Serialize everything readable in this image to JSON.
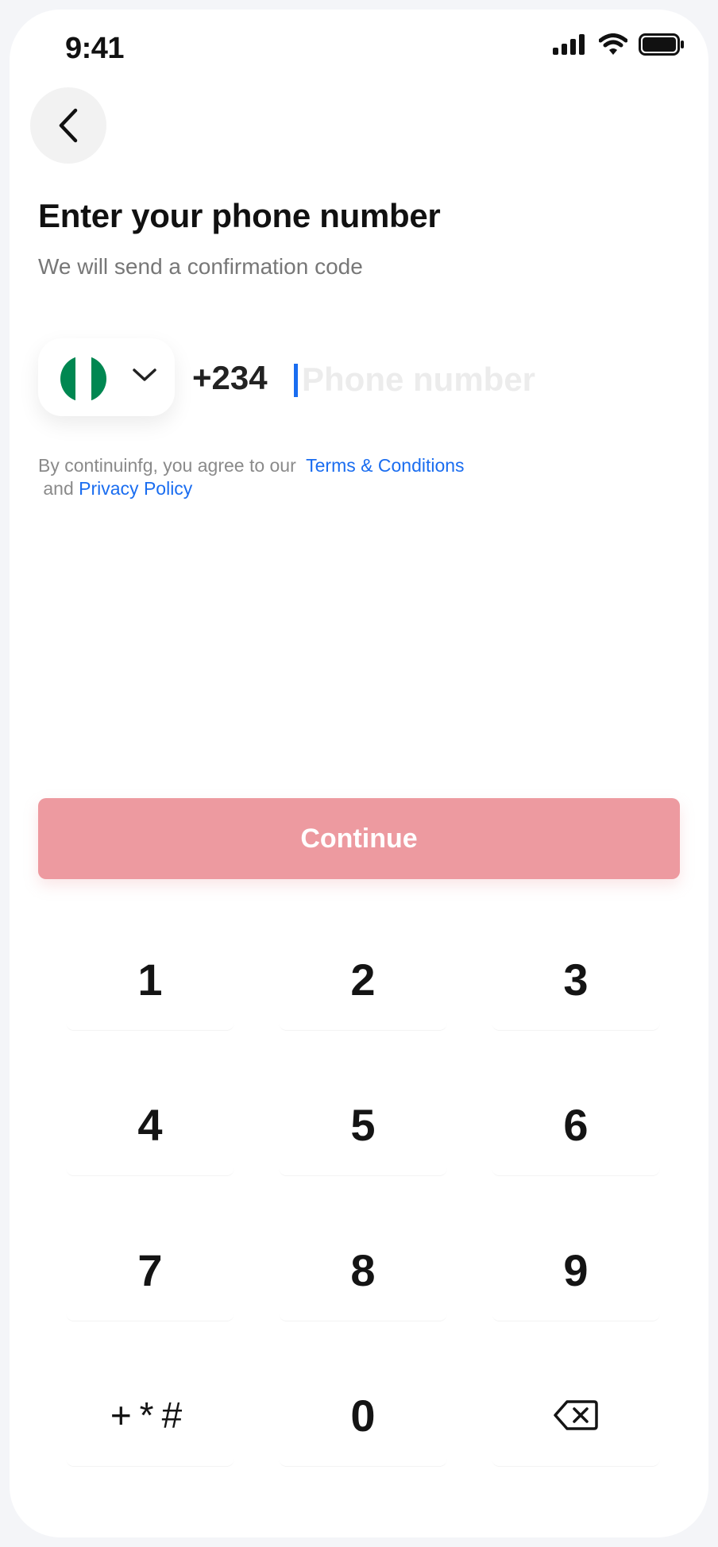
{
  "status_bar": {
    "time": "9:41",
    "icons": [
      "cellular-signal-icon",
      "wifi-icon",
      "battery-icon"
    ]
  },
  "header": {
    "back_icon": "chevron-left-icon"
  },
  "title": "Enter your phone number",
  "subtitle": "We will send a confirmation code",
  "phone_field": {
    "country_flag": "nigeria-flag-icon",
    "flag_colors": [
      "#008751",
      "#ffffff",
      "#008751"
    ],
    "dial_code": "+234",
    "value": "",
    "placeholder": "Phone number"
  },
  "terms": {
    "prefix": "By continuinfg, you agree to our",
    "terms_link": "Terms & Conditions",
    "connector": "and",
    "privacy_link": "Privacy Policy"
  },
  "continue_label": "Continue",
  "keypad": {
    "keys": [
      "1",
      "2",
      "3",
      "4",
      "5",
      "6",
      "7",
      "8",
      "9",
      "+*#",
      "0"
    ],
    "delete_icon": "backspace-icon"
  },
  "colors": {
    "accent": "#1a6df0",
    "continue_disabled": "#ed9aa0"
  }
}
